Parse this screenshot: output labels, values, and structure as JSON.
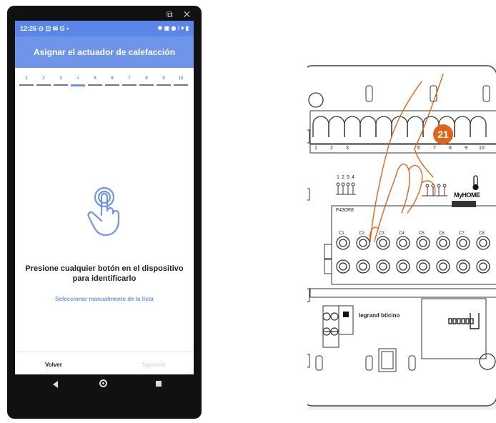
{
  "status_bar": {
    "time": "12:26",
    "left_icons": "⊙ ⊡ ✉ G •",
    "right_icons": "✱ ▣ ◉ ⁝ ▾ ▮"
  },
  "header": {
    "title": "Asignar el actuador de calefacción"
  },
  "steps": {
    "labels": [
      "1",
      "2",
      "3",
      "4",
      "5",
      "6",
      "7",
      "8",
      "9",
      "10"
    ],
    "current": 4
  },
  "main": {
    "message": "Presione cualquier botón en el dispositivo para identificarlo",
    "manual_link": "Seleccionar manualmente de la lista"
  },
  "footer": {
    "back_label": "Volver",
    "next_label": "Siguiente"
  },
  "icons": {
    "touch": "touch-icon",
    "nav_back": "back-triangle-icon",
    "nav_home": "home-circle-icon",
    "nav_recent": "recent-square-icon"
  },
  "colors": {
    "accent": "#6e95ea",
    "status_bar": "#5a86e8",
    "badge": "#e0641c"
  },
  "device": {
    "terminal_numbers": [
      "1",
      "2",
      "3",
      "6",
      "7",
      "8",
      "9",
      "10"
    ],
    "sensor_terminals": [
      "1",
      "2",
      "3",
      "4"
    ],
    "channel_labels": [
      "C1",
      "C2",
      "C3",
      "C4",
      "C5",
      "C6",
      "C7",
      "C8"
    ],
    "model": "F430R8",
    "brand": "legrand bticino",
    "logo": "MyHOME",
    "badge_number": "21"
  }
}
